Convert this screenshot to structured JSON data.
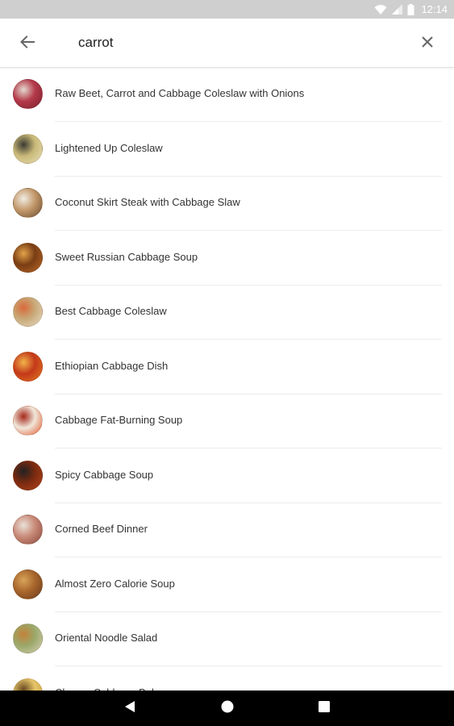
{
  "status_bar": {
    "time": "12:14",
    "icons": [
      "wifi-icon",
      "cell-signal-icon",
      "battery-icon"
    ]
  },
  "search": {
    "query": "carrot",
    "back_icon": "arrow-left-icon",
    "clear_icon": "close-icon"
  },
  "results": [
    {
      "title": "Raw Beet, Carrot and Cabbage Coleslaw with Onions",
      "colors": [
        "#7a1f2b",
        "#b43a4a",
        "#e4d9cf"
      ]
    },
    {
      "title": "Lightened Up Coleslaw",
      "colors": [
        "#e8dfb8",
        "#c9b978",
        "#3a3a32"
      ]
    },
    {
      "title": "Coconut Skirt Steak with Cabbage Slaw",
      "colors": [
        "#6b4a2e",
        "#c49a6c",
        "#f1ece3"
      ]
    },
    {
      "title": "Sweet Russian Cabbage Soup",
      "colors": [
        "#b8692a",
        "#7a3d14",
        "#e1a24a"
      ]
    },
    {
      "title": "Best Cabbage Coleslaw",
      "colors": [
        "#e7dcc4",
        "#c8a978",
        "#d96a3a"
      ]
    },
    {
      "title": "Ethiopian Cabbage Dish",
      "colors": [
        "#e07a1e",
        "#c4391a",
        "#f2b34a"
      ]
    },
    {
      "title": "Cabbage Fat-Burning Soup",
      "colors": [
        "#e2572a",
        "#f0e7da",
        "#a5281a"
      ]
    },
    {
      "title": "Spicy Cabbage Soup",
      "colors": [
        "#b5421c",
        "#7a2a10",
        "#222222"
      ]
    },
    {
      "title": "Corned Beef Dinner",
      "colors": [
        "#8a4a3e",
        "#c98a78",
        "#e9e2d8"
      ]
    },
    {
      "title": "Almost Zero Calorie Soup",
      "colors": [
        "#6a3b1e",
        "#a8662c",
        "#d9a45a"
      ]
    },
    {
      "title": "Oriental Noodle Salad",
      "colors": [
        "#d8cfb4",
        "#9aa86a",
        "#c4823a"
      ]
    },
    {
      "title": "Cheesy Cabbage Bake",
      "colors": [
        "#c99a3a",
        "#e5c46a",
        "#6a4a20"
      ]
    }
  ],
  "nav": {
    "back_icon": "nav-back-triangle-icon",
    "home_icon": "nav-home-circle-icon",
    "recents_icon": "nav-recents-square-icon"
  }
}
